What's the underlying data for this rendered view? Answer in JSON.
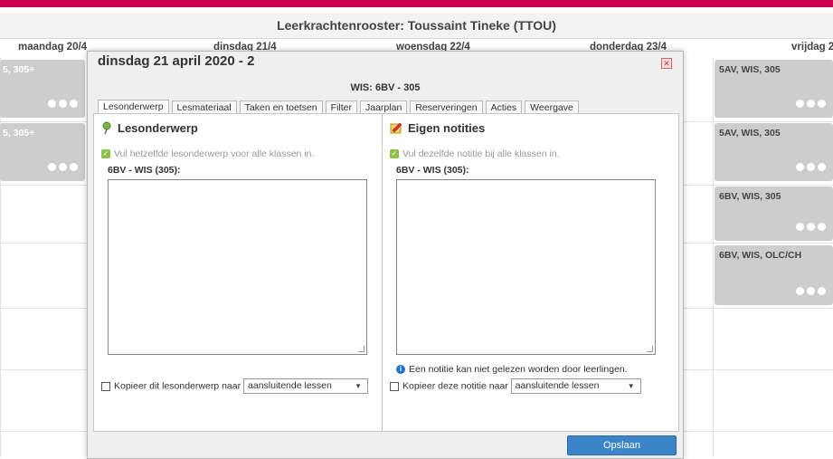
{
  "app": {
    "title": "Leerkrachtenrooster: Toussaint Tineke (TTOU)"
  },
  "days": [
    "maandag 20/4",
    "dinsdag 21/4",
    "woensdag 22/4",
    "donderdag 23/4",
    "vrijdag 2"
  ],
  "schedule": {
    "left_cards": [
      {
        "label": "5, 305+"
      },
      {
        "label": "5, 305+"
      }
    ],
    "right_cards": [
      {
        "label": "5AV, WIS, 305"
      },
      {
        "label": "5AV, WIS, 305"
      },
      {
        "label": "6BV, WIS, 305"
      },
      {
        "label": "6BV, WIS, OLC/CH"
      }
    ]
  },
  "dialog": {
    "title": "dinsdag 21 april 2020 - 2",
    "subheading": "WIS: 6BV - 305",
    "close_icon": "close-icon",
    "tabs": [
      {
        "label": "Lesonderwerp",
        "active": true
      },
      {
        "label": "Lesmateriaal"
      },
      {
        "label": "Taken en toetsen"
      },
      {
        "label": "Filter"
      },
      {
        "label": "Jaarplan"
      },
      {
        "label": "Reserveringen"
      },
      {
        "label": "Acties"
      },
      {
        "label": "Weergave"
      }
    ],
    "left": {
      "title": "Lesonderwerp",
      "icon": "pin-icon",
      "check_text": "Vul hetzelfde lesonderwerp voor alle klassen in.",
      "field_label": "6BV - WIS (305):",
      "textarea_value": "",
      "copy_label": "Kopieer dit lesonderwerp naar",
      "select_value": "aansluitende lessen"
    },
    "right": {
      "title": "Eigen notities",
      "icon": "note-icon",
      "check_text": "Vul dezelfde notitie bij alle klassen in.",
      "field_label": "6BV - WIS (305):",
      "textarea_value": "",
      "info_text": "Een notitie kan niet gelezen worden door leerlingen.",
      "copy_label": "Kopieer deze notitie naar",
      "select_value": "aansluitende lessen"
    },
    "save_label": "Opslaan"
  },
  "colors": {
    "accent_bar": "#c8004e",
    "card": "#cdcdcd",
    "primary_button": "#3b85c8"
  }
}
